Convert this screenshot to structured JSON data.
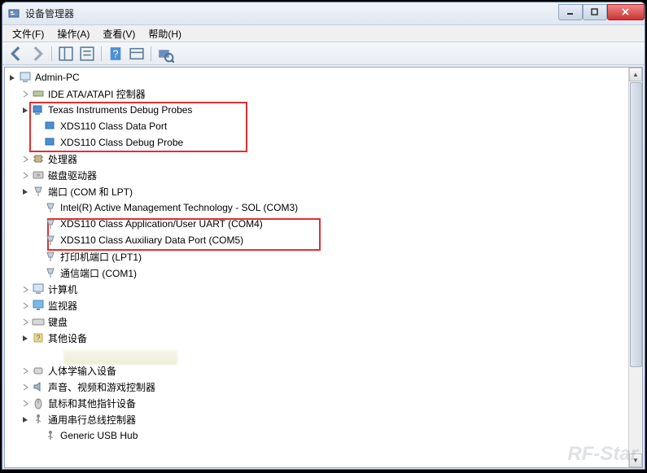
{
  "window": {
    "title": "设备管理器"
  },
  "menu": {
    "file": "文件(F)",
    "action": "操作(A)",
    "view": "查看(V)",
    "help": "帮助(H)"
  },
  "tree": {
    "root": "Admin-PC",
    "ide": "IDE ATA/ATAPI 控制器",
    "ti_probes": "Texas Instruments Debug Probes",
    "xds_data": "XDS110 Class Data Port",
    "xds_debug": "XDS110 Class Debug Probe",
    "cpu": "处理器",
    "disk": "磁盘驱动器",
    "ports": "端口 (COM 和 LPT)",
    "port_sol": "Intel(R) Active Management Technology - SOL (COM3)",
    "port_uart": "XDS110 Class Application/User UART (COM4)",
    "port_aux": "XDS110 Class Auxiliary Data Port (COM5)",
    "port_lpt": "打印机端口 (LPT1)",
    "port_com1": "通信端口 (COM1)",
    "computer": "计算机",
    "monitor": "监视器",
    "keyboard": "键盘",
    "other": "其他设备",
    "hid": "人体学输入设备",
    "sound": "声音、视频和游戏控制器",
    "mouse": "鼠标和其他指针设备",
    "usb": "通用串行总线控制器",
    "usb_hub": "Generic USB Hub"
  },
  "watermark": "RF-Star"
}
